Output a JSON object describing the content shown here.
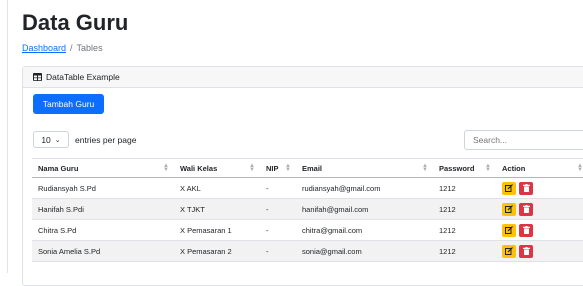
{
  "page": {
    "title": "Data Guru"
  },
  "breadcrumb": {
    "link": "Dashboard",
    "separator": "/",
    "current": "Tables"
  },
  "card": {
    "header": "DataTable Example",
    "header_icon": "table-icon"
  },
  "toolbar": {
    "add_button": "Tambah Guru"
  },
  "entries": {
    "value": "10",
    "label": "entries per page"
  },
  "search": {
    "placeholder": "Search..."
  },
  "table": {
    "columns": [
      "Nama Guru",
      "Wali Kelas",
      "NIP",
      "Email",
      "Password",
      "Action"
    ],
    "rows": [
      {
        "nama": "Rudiansyah S.Pd",
        "wali": "X AKL",
        "nip": "-",
        "email": "rudiansyah@gmail.com",
        "password": "1212"
      },
      {
        "nama": "Hanifah S.Pdi",
        "wali": "X TJKT",
        "nip": "-",
        "email": "hanifah@gmail.com",
        "password": "1212"
      },
      {
        "nama": "Chitra S.Pd",
        "wali": "X Pemasaran 1",
        "nip": "-",
        "email": "chitra@gmail.com",
        "password": "1212"
      },
      {
        "nama": "Sonia Amelia S.Pd",
        "wali": "X Pemasaran 2",
        "nip": "-",
        "email": "sonia@gmail.com",
        "password": "1212"
      }
    ]
  },
  "colors": {
    "primary": "#0d6efd",
    "warning": "#ffc107",
    "danger": "#dc3545"
  }
}
